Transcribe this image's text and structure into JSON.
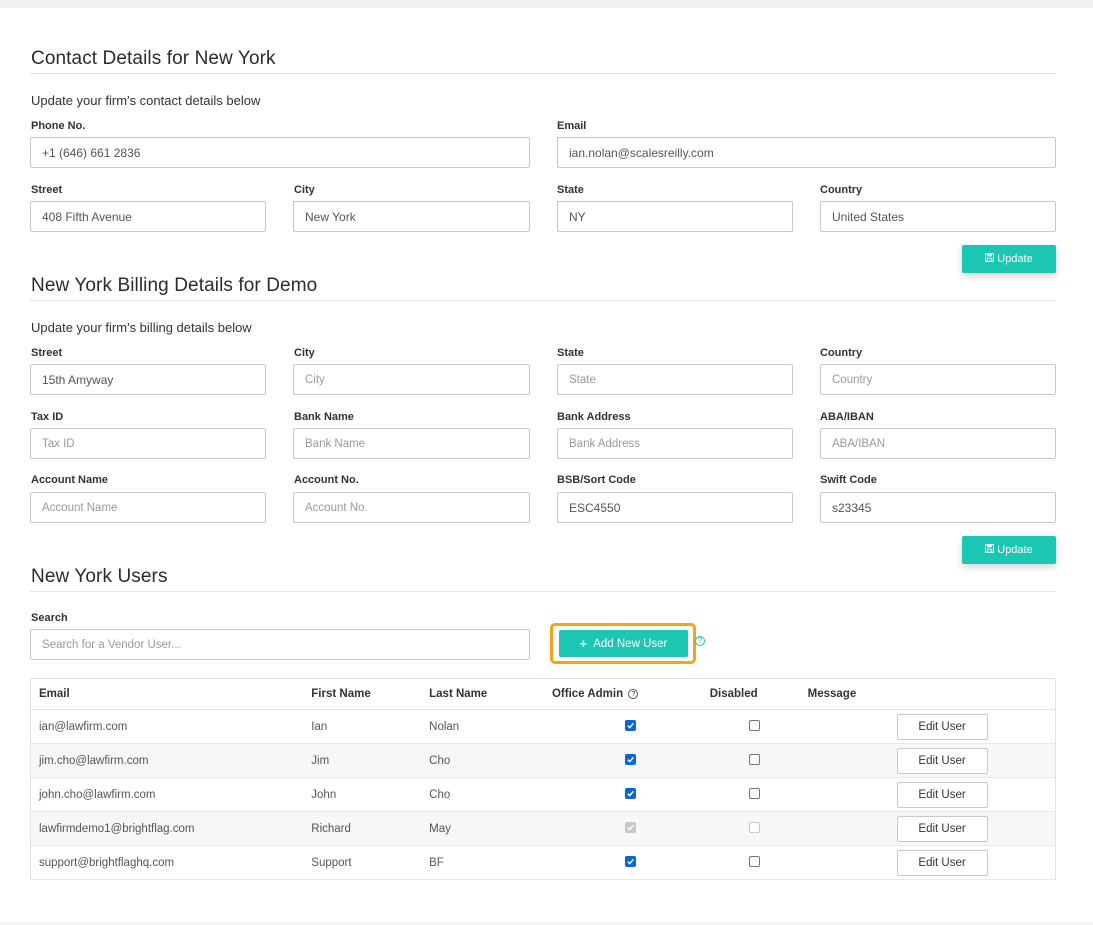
{
  "contact": {
    "title": "Contact Details for New York",
    "subtitle": "Update your firm's contact details below",
    "phone_label": "Phone No.",
    "phone_value": "+1 (646) 661 2836",
    "email_label": "Email",
    "email_value": "ian.nolan@scalesreilly.com",
    "street_label": "Street",
    "street_value": "408 Fifth Avenue",
    "city_label": "City",
    "city_value": "New York",
    "state_label": "State",
    "state_value": "NY",
    "country_label": "Country",
    "country_value": "United States",
    "update_label": "Update"
  },
  "billing": {
    "title": "New York Billing Details for Demo",
    "subtitle": "Update your firm's billing details below",
    "street_label": "Street",
    "street_value": "15th Amyway",
    "city_label": "City",
    "city_placeholder": "City",
    "state_label": "State",
    "state_placeholder": "State",
    "country_label": "Country",
    "country_placeholder": "Country",
    "taxid_label": "Tax ID",
    "taxid_placeholder": "Tax ID",
    "bankname_label": "Bank Name",
    "bankname_placeholder": "Bank Name",
    "bankaddress_label": "Bank Address",
    "bankaddress_placeholder": "Bank Address",
    "aba_label": "ABA/IBAN",
    "aba_placeholder": "ABA/IBAN",
    "accountname_label": "Account Name",
    "accountname_placeholder": "Account Name",
    "accountno_label": "Account No.",
    "accountno_placeholder": "Account No.",
    "bsb_label": "BSB/Sort Code",
    "bsb_value": "ESC4550",
    "swift_label": "Swift Code",
    "swift_value": "s23345",
    "update_label": "Update"
  },
  "users": {
    "title": "New York Users",
    "search_label": "Search",
    "search_placeholder": "Search for a Vendor User...",
    "add_label": "Add New User",
    "help_glyph": "?",
    "columns": [
      "Email",
      "First Name",
      "Last Name",
      "Office Admin",
      "Disabled",
      "Message"
    ],
    "edit_label": "Edit User",
    "rows": [
      {
        "email": "ian@lawfirm.com",
        "first": "Ian",
        "last": "Nolan",
        "admin": "checked",
        "disabled": "unchecked"
      },
      {
        "email": "jim.cho@lawfirm.com",
        "first": "Jim",
        "last": "Cho",
        "admin": "checked",
        "disabled": "unchecked"
      },
      {
        "email": "john.cho@lawfirm.com",
        "first": "John",
        "last": "Cho",
        "admin": "checked",
        "disabled": "unchecked"
      },
      {
        "email": "lawfirmdemo1@brightflag.com",
        "first": "Richard",
        "last": "May",
        "admin": "checked-disabled",
        "disabled": "unchecked-disabled"
      },
      {
        "email": "support@brightflaghq.com",
        "first": "Support",
        "last": "BF",
        "admin": "checked",
        "disabled": "unchecked"
      }
    ]
  },
  "icons": {
    "save": "floppy-disk-icon",
    "plus": "plus-icon",
    "help": "question-circle-icon",
    "check": "check-icon"
  },
  "colors": {
    "accent": "#1dc6b3",
    "highlight": "#f7a21a",
    "checkbox": "#0a66d6"
  }
}
